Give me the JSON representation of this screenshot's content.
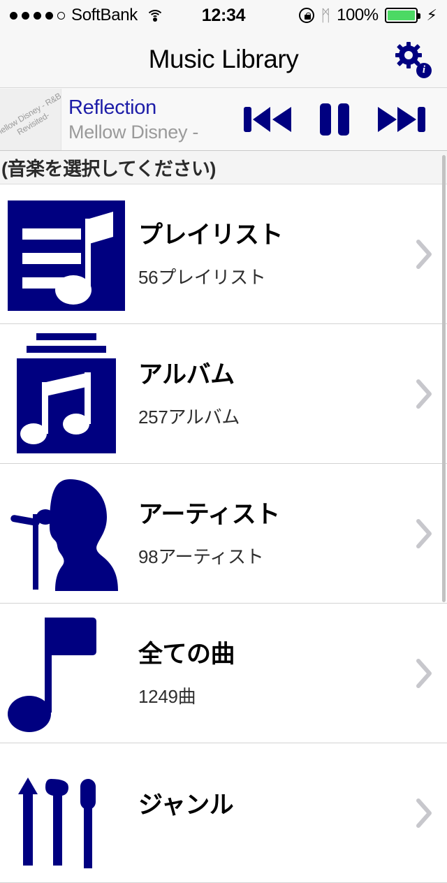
{
  "status_bar": {
    "carrier": "SoftBank",
    "signal_dots_filled": 4,
    "signal_dots_total": 5,
    "wifi_icon": "wifi-icon",
    "time": "12:34",
    "rotation_lock_icon": "rotation-lock-icon",
    "bluetooth_icon": "bluetooth-icon",
    "bluetooth_glyph": "ᛗ",
    "battery_percent": "100%",
    "battery_fill_color": "#4cd964",
    "charging_glyph": "⚡",
    "charging_icon": "charging-bolt-icon"
  },
  "nav_bar": {
    "title": "Music Library",
    "settings_icon": "gear-info-icon",
    "info_badge_letter": "i",
    "accent_color": "#000080"
  },
  "now_playing": {
    "artwork_text": "Mellow Disney - R&B Revisited-",
    "track_title": "Reflection",
    "track_subtitle": "Mellow Disney -",
    "title_color": "#1d1da8",
    "subtitle_color": "#9a9a9a",
    "controls": [
      {
        "name": "previous-button",
        "icon": "rewind-icon"
      },
      {
        "name": "pause-button",
        "icon": "pause-icon"
      },
      {
        "name": "next-button",
        "icon": "fast-forward-icon"
      }
    ]
  },
  "section_header": {
    "label": "(音楽を選択してください)"
  },
  "list": {
    "rows": [
      {
        "title": "プレイリスト",
        "subtitle": "56プレイリスト",
        "icon": "playlist-icon",
        "name": "list-item-playlists"
      },
      {
        "title": "アルバム",
        "subtitle": "257アルバム",
        "icon": "albums-icon",
        "name": "list-item-albums"
      },
      {
        "title": "アーティスト",
        "subtitle": "98アーティスト",
        "icon": "artist-singer-icon",
        "name": "list-item-artists"
      },
      {
        "title": "全ての曲",
        "subtitle": "1249曲",
        "icon": "music-note-icon",
        "name": "list-item-all-songs"
      },
      {
        "title": "ジャンル",
        "subtitle": "",
        "icon": "genres-instruments-icon",
        "name": "list-item-genres"
      }
    ],
    "chevron_icon": "chevron-right-icon",
    "chevron_color": "#c7c7cc"
  }
}
